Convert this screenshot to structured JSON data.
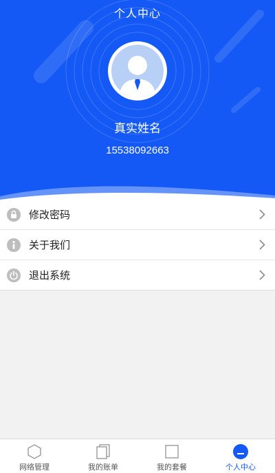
{
  "header": {
    "title": "个人中心",
    "user_name": "真实姓名",
    "phone": "15538092663"
  },
  "menu": {
    "items": [
      {
        "label": "修改密码",
        "icon": "lock-icon"
      },
      {
        "label": "关于我们",
        "icon": "info-icon"
      },
      {
        "label": "退出系统",
        "icon": "power-icon"
      }
    ]
  },
  "tabbar": {
    "tabs": [
      {
        "label": "网络管理",
        "icon": "hexagon-icon",
        "active": false
      },
      {
        "label": "我的账单",
        "icon": "bill-icon",
        "active": false
      },
      {
        "label": "我的套餐",
        "icon": "package-icon",
        "active": false
      },
      {
        "label": "个人中心",
        "icon": "user-center-icon",
        "active": true
      }
    ]
  },
  "colors": {
    "primary": "#1459f5",
    "background": "#f2f2f2",
    "icon_gray": "#bdbdbd"
  }
}
